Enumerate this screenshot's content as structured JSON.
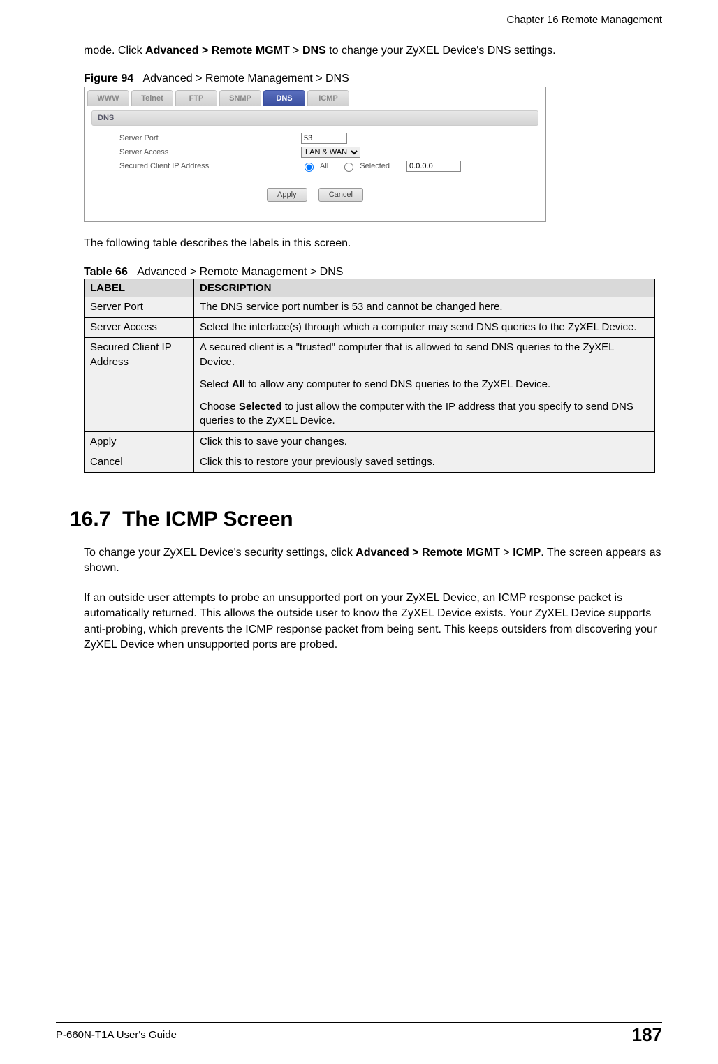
{
  "header": {
    "chapter": "Chapter 16 Remote Management"
  },
  "intro_text": {
    "part1": "mode. Click ",
    "bold1": "Advanced > Remote MGMT",
    "part2": " > ",
    "bold2": "DNS",
    "part3": " to change your ZyXEL Device's DNS settings."
  },
  "figure": {
    "label": "Figure 94",
    "caption": "Advanced > Remote Management > DNS"
  },
  "screenshot": {
    "tabs": [
      "WWW",
      "Telnet",
      "FTP",
      "SNMP",
      "DNS",
      "ICMP"
    ],
    "active_tab": "DNS",
    "section_title": "DNS",
    "rows": {
      "server_port_label": "Server Port",
      "server_port_value": "53",
      "server_access_label": "Server Access",
      "server_access_value": "LAN & WAN",
      "secured_label": "Secured Client IP Address",
      "radio_all": "All",
      "radio_selected": "Selected",
      "ip_value": "0.0.0.0"
    },
    "buttons": {
      "apply": "Apply",
      "cancel": "Cancel"
    }
  },
  "after_figure_text": "The following table describes the labels in this screen.",
  "table": {
    "label": "Table 66",
    "caption": "Advanced > Remote Management > DNS",
    "headers": [
      "LABEL",
      "DESCRIPTION"
    ],
    "rows": [
      {
        "label": "Server Port",
        "desc": [
          {
            "t": "The DNS service port number is 53 and cannot be changed here."
          }
        ]
      },
      {
        "label": "Server Access",
        "desc": [
          {
            "t": "Select the interface(s) through which a computer may send DNS queries to the ZyXEL Device."
          }
        ]
      },
      {
        "label": "Secured Client IP Address",
        "desc": [
          {
            "t": "A secured client is a \"trusted\" computer that is allowed to send DNS queries to the ZyXEL Device."
          },
          {
            "pre": "Select ",
            "b": "All",
            "post": " to allow any computer to send DNS queries to the ZyXEL Device."
          },
          {
            "pre": "Choose ",
            "b": "Selected",
            "post": " to just allow the computer with the IP address that you specify to send DNS queries to the ZyXEL Device."
          }
        ]
      },
      {
        "label": "Apply",
        "desc": [
          {
            "t": "Click this to save your changes."
          }
        ]
      },
      {
        "label": "Cancel",
        "desc": [
          {
            "t": "Click this to restore your previously saved settings."
          }
        ]
      }
    ]
  },
  "section": {
    "number": "16.7",
    "title": "The ICMP Screen",
    "para1": {
      "pre": "To change your ZyXEL Device's security settings, click ",
      "b1": "Advanced > Remote MGMT",
      "mid": " > ",
      "b2": "ICMP",
      "post": ". The screen appears as shown."
    },
    "para2": "If an outside user attempts to probe an unsupported port on your ZyXEL Device, an ICMP response packet is automatically returned. This allows the outside user to know the ZyXEL Device exists. Your ZyXEL Device supports anti-probing, which prevents the ICMP response packet from being sent. This keeps outsiders from discovering your ZyXEL Device when unsupported ports are probed."
  },
  "footer": {
    "guide": "P-660N-T1A User's Guide",
    "page": "187"
  }
}
